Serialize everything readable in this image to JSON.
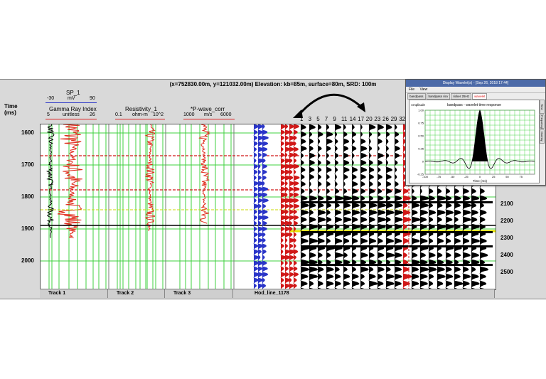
{
  "header": {
    "coords": "(x=752830.00m, y=121032.00m) Elevation: kb=85m, surface=80m, SRD: 100m",
    "time_label": "Time",
    "time_unit": "(ms)"
  },
  "logs": {
    "sp": {
      "name": "SP_1",
      "unit": "mV",
      "min": "-30",
      "max": "90"
    },
    "gamma": {
      "name": "Gamma Ray Index",
      "unit": "unitless",
      "min": "5",
      "max": "26"
    },
    "resistivity": {
      "name": "Resistivity_1",
      "unit": "ohm-m",
      "min": "0.1",
      "max": "10^2"
    },
    "pwave": {
      "name": "*P-wave_corr",
      "unit": "m/s",
      "min": "1000",
      "max": "6000"
    }
  },
  "time_ticks": [
    "1600",
    "1700",
    "1800",
    "1900",
    "2000"
  ],
  "depth_ticks": [
    "2100",
    "2200",
    "2300",
    "2400",
    "2500"
  ],
  "trace_numbers": [
    "1",
    "3",
    "5",
    "7",
    "9",
    "11",
    "14",
    "17",
    "20",
    "23",
    "26",
    "29",
    "32"
  ],
  "tracks": [
    "Track 1",
    "Track 2",
    "Track 3",
    "Hod_line_1178"
  ],
  "wavelet_window": {
    "title": "Display Wavelet(s) - [Sep 26, 2018 17:44]",
    "menu": [
      "File",
      "View"
    ],
    "tabs": [
      "bandpass",
      "bandpass ricv",
      "ricker 25Hz",
      "wavelet"
    ],
    "side_tabs": [
      "Time",
      "Frequency",
      "Overlay"
    ],
    "plot_title": "bandpass - wavelet time response",
    "y_label": "Amplitude",
    "x_label": "Time (ms)",
    "y_ticks": [
      "1.00",
      "0.75",
      "0.50",
      "0.25",
      "0",
      "-0.25"
    ],
    "x_ticks": [
      "-100",
      "-75",
      "-50",
      "-25",
      "0",
      "25",
      "50",
      "75"
    ]
  },
  "colors": {
    "grid": "#3fd13f",
    "log": "#e02a1a",
    "accent_blue": "#2a35c8",
    "marker_red": "#d01818",
    "marker_yellow": "#e6e600",
    "bg": "#d9d9d9"
  }
}
